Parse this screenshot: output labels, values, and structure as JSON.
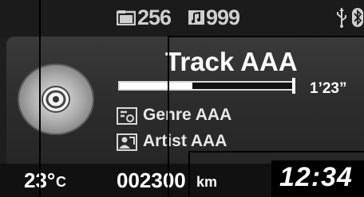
{
  "status_bar": {
    "folder_icon": "folder-icon",
    "folder_count": "256",
    "music_icon": "music-icon",
    "track_count": "999",
    "usb_icon": "usb-icon",
    "bluetooth_icon": "bluetooth-icon"
  },
  "now_playing": {
    "disc_icon": "disc-icon",
    "track_title": "Track AAA",
    "elapsed_time": "1’23”",
    "progress_fraction": 0.42,
    "genre_icon": "genre-icon",
    "genre": "Genre AAA",
    "artist_icon": "artist-icon",
    "artist": "Artist AAA"
  },
  "info_bar": {
    "temperature": "23°",
    "temperature_unit": "C",
    "odometer": "002300",
    "odometer_unit": "km",
    "clock": "12:34"
  },
  "colors": {
    "background": "#1e1e1e",
    "text": "#ffffff",
    "muted_text": "#cfcfcf"
  }
}
